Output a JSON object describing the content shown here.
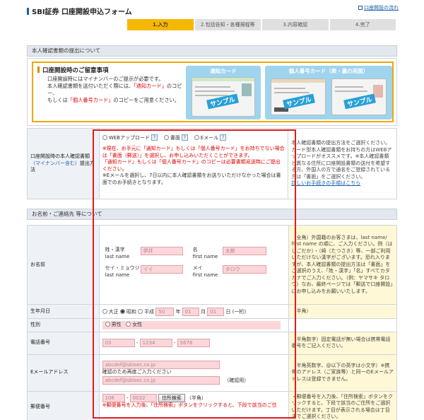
{
  "header": {
    "title": "SBI証券 口座開設申込フォーム",
    "flow_link": "口座開設の流れ"
  },
  "steps": [
    {
      "label": "1.入力",
      "active": true
    },
    {
      "label": "2.包括告知・各種規程等",
      "active": false
    },
    {
      "label": "3.内容確認",
      "active": false
    },
    {
      "label": "4.完了",
      "active": false
    }
  ],
  "sections": {
    "id_doc": "本人確認書類の提出について",
    "name_contact": "お名前・ご連絡先 等について"
  },
  "notice": {
    "title": "口座開設時のご留意事項",
    "line1": "口座開設時にはマイナンバーのご提示が必要です。",
    "line2a": "本人確認書類を送付いただく際には、",
    "line2b": "「通知カード」",
    "line2c": "のコピー、",
    "line3a": "もしくは",
    "line3b": "「個人番号カード」",
    "line3c": "のコピーをご用意ください。",
    "card1_caption": "通知カード",
    "card2_caption": "個人番号カード（表・裏の両面）",
    "sample": "サンプル"
  },
  "id_submit": {
    "label_a": "口座開設時の本人確認書類",
    "label_b": "（マイナンバー含む）",
    "label_c": "提出方法",
    "options": [
      "WEBアップロード",
      "書面",
      "Eメール"
    ],
    "warn1": "※現在、お手元に「通知カード」もしくは「個人番号カード」をお持ちでない場合は「書面（郵送）」を選択し、お申し込みいただくことができます。",
    "warn2": "「通知カード」もしくは「個人番号カード」のコピーは必要書類返送時にご提出ください。",
    "note": "※Eメールを選択し、7日以内に本人確認書類をお送りいただけなかった場合は書面でのお手続きとなります。",
    "hint": "本人確認書類の提出方法をご選択ください。カード型本人確認書類をお持ちの方はWEBアップロードがオススメです。※本人確認書類と異なる住所に口座開設書類の送付を希望する方、外国人の方で通名をご登録されている方は「書面」をご選択ください。",
    "hint_link": "詳しいお手続きの手順はこちら"
  },
  "name": {
    "label": "お名前",
    "sei_label": "姓・漢字",
    "last_name_label": "last name",
    "sei_value": "伊井",
    "mei_label": "名",
    "first_name_label": "first name",
    "mei_value": "太郎",
    "sei_kana_label": "セイ・ミョウジ",
    "last_name_label2": "last name",
    "sei_kana_value": "イイ",
    "mei_kana_label": "メイ",
    "first_name_label2": "first name",
    "mei_kana_value": "タロウ",
    "hint": "（全角）外国籍のお客さまは、last name/ first name の順に、ご入力ください。例（はしごだか）・（崎（たつさき）等、一部ご利用いただけない漢字がございます。恐れ入りますが、本人確認書類の提出方法は「書面」をご選択のうえ、「姓・漢字」「名」すべてカタカナでご入力ください。（例：ヤマサキ タロウ）なお、最終ページでは「郵送で口座開設」にお申し込みをお願いいたします。"
  },
  "birth": {
    "label": "生年月日",
    "eras": [
      "大正",
      "昭和",
      "平成"
    ],
    "selected": "昭和",
    "year": "50",
    "year_unit": "年",
    "month": "01",
    "month_unit": "月",
    "day": "01",
    "day_unit": "日",
    "fmt": "(一桁)",
    "hint": "（半角）"
  },
  "gender": {
    "label": "性別",
    "options": [
      "男性",
      "女性"
    ]
  },
  "phone": {
    "label": "電話番号",
    "p1": "03",
    "p2": "1234",
    "p3": "5678",
    "hint": "（半角数字）固定電話が無い場合は携帯電話番号をご記入ください。"
  },
  "email": {
    "label": "Eメールアドレス",
    "value": "abcdef@sbisec.co.jp",
    "confirm_note": "確認のため再度ご入力ください",
    "confirm_value": "abcdef@sbisec.co.jp",
    "confirm_label": "（確認用）",
    "hint": "（半角英数字、@以下の英字は小文字）※携帯のアドレス（ご家族等）と同一のEメールアドレスは登録できません。"
  },
  "postal": {
    "label": "郵便番号",
    "p1": "106",
    "p2": "0032",
    "search_button": "住所検索",
    "unit": "（半角）",
    "warn": "※郵便番号を入力後、「住所検索」ボタンをクリックすると、下段で該当のご住",
    "hint": "・郵便番号を入力後、「住所検索」ボタンをクリックすると、下段で該当のご住所をご選択いただけます。丁目が表示される場合は丁目までご選択ください。"
  }
}
